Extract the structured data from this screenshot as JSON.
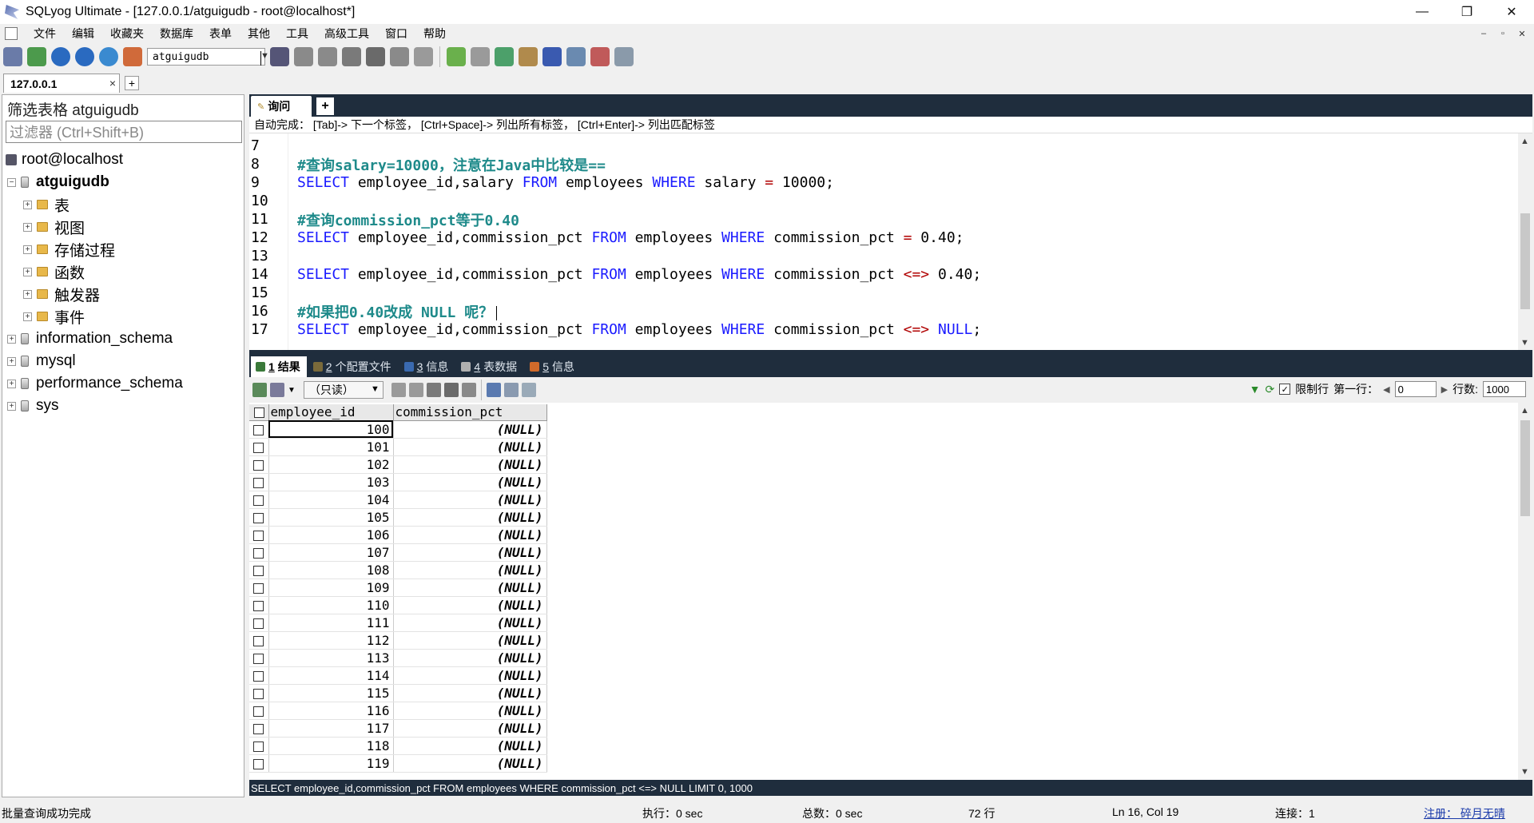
{
  "window": {
    "title": "SQLyog Ultimate - [127.0.0.1/atguigudb - root@localhost*]",
    "controls": [
      "—",
      "❐",
      "✕"
    ]
  },
  "menu": {
    "items": [
      "文件",
      "编辑",
      "收藏夹",
      "数据库",
      "表单",
      "其他",
      "工具",
      "高级工具",
      "窗口",
      "帮助"
    ],
    "mdi_controls": [
      "–",
      "▫",
      "✕"
    ]
  },
  "toolbar": {
    "db_selector": "atguigudb"
  },
  "connection_tab": {
    "label": "127.0.0.1",
    "close": "×",
    "add": "+"
  },
  "object_browser": {
    "filter_title": "筛选表格 atguigudb",
    "filter_placeholder": "过滤器 (Ctrl+Shift+B)",
    "server": "root@localhost",
    "current_db": "atguigudb",
    "folders": [
      "表",
      "视图",
      "存储过程",
      "函数",
      "触发器",
      "事件"
    ],
    "other_dbs": [
      "information_schema",
      "mysql",
      "performance_schema",
      "sys"
    ]
  },
  "query_tab": {
    "label": "询问",
    "add": "+"
  },
  "autocomplete_hint": "自动完成： [Tab]-> 下一个标签， [Ctrl+Space]-> 列出所有标签， [Ctrl+Enter]-> 列出匹配标签",
  "editor": {
    "lines": [
      {
        "n": "7",
        "parts": []
      },
      {
        "n": "8",
        "parts": [
          {
            "t": "#查询salary=10000，注意在Java中比较是==",
            "c": "cm"
          }
        ]
      },
      {
        "n": "9",
        "parts": [
          {
            "t": "SELECT",
            "c": "kw"
          },
          {
            "t": " employee_id,salary ",
            "c": ""
          },
          {
            "t": "FROM",
            "c": "kw"
          },
          {
            "t": " employees ",
            "c": ""
          },
          {
            "t": "WHERE",
            "c": "kw"
          },
          {
            "t": " salary ",
            "c": ""
          },
          {
            "t": "=",
            "c": "op"
          },
          {
            "t": " 10000;",
            "c": ""
          }
        ]
      },
      {
        "n": "10",
        "parts": []
      },
      {
        "n": "11",
        "parts": [
          {
            "t": "#查询commission_pct等于0.40",
            "c": "cm"
          }
        ]
      },
      {
        "n": "12",
        "parts": [
          {
            "t": "SELECT",
            "c": "kw"
          },
          {
            "t": " employee_id,commission_pct ",
            "c": ""
          },
          {
            "t": "FROM",
            "c": "kw"
          },
          {
            "t": " employees ",
            "c": ""
          },
          {
            "t": "WHERE",
            "c": "kw"
          },
          {
            "t": " commission_pct ",
            "c": ""
          },
          {
            "t": "=",
            "c": "op"
          },
          {
            "t": " 0.40;",
            "c": ""
          }
        ]
      },
      {
        "n": "13",
        "parts": []
      },
      {
        "n": "14",
        "parts": [
          {
            "t": "SELECT",
            "c": "kw"
          },
          {
            "t": " employee_id,commission_pct ",
            "c": ""
          },
          {
            "t": "FROM",
            "c": "kw"
          },
          {
            "t": " employees ",
            "c": ""
          },
          {
            "t": "WHERE",
            "c": "kw"
          },
          {
            "t": " commission_pct ",
            "c": ""
          },
          {
            "t": "<=>",
            "c": "op"
          },
          {
            "t": " 0.40;",
            "c": ""
          }
        ]
      },
      {
        "n": "15",
        "parts": []
      },
      {
        "n": "16",
        "parts": [
          {
            "t": "#如果把0.40改成 NULL 呢？",
            "c": "cm"
          }
        ],
        "caret": true
      },
      {
        "n": "17",
        "parts": [
          {
            "t": "SELECT",
            "c": "kw"
          },
          {
            "t": " employee_id,commission_pct ",
            "c": ""
          },
          {
            "t": "FROM",
            "c": "kw"
          },
          {
            "t": " employees ",
            "c": ""
          },
          {
            "t": "WHERE",
            "c": "kw"
          },
          {
            "t": " commission_pct ",
            "c": ""
          },
          {
            "t": "<=>",
            "c": "op"
          },
          {
            "t": " ",
            "c": ""
          },
          {
            "t": "NULL",
            "c": "kw"
          },
          {
            "t": ";",
            "c": ""
          }
        ]
      }
    ]
  },
  "result_tabs": [
    {
      "num": "1",
      "label": "结果",
      "active": true,
      "color": "#3a7a3a"
    },
    {
      "num": "2",
      "label": "个配置文件",
      "active": false,
      "color": "#7a6a3a"
    },
    {
      "num": "3",
      "label": "信息",
      "active": false,
      "color": "#3a6ab0"
    },
    {
      "num": "4",
      "label": "表数据",
      "active": false,
      "color": "#b0b0b0"
    },
    {
      "num": "5",
      "label": "信息",
      "active": false,
      "color": "#d06a2a"
    }
  ],
  "result_toolbar": {
    "mode": "（只读）",
    "limit_label": "限制行",
    "limit_checked": true,
    "first_row_label": "第一行：",
    "first_row_value": "0",
    "rows_label": "行数:",
    "rows_value": "1000"
  },
  "grid": {
    "columns": [
      "employee_id",
      "commission_pct"
    ],
    "rows": [
      [
        "100",
        "(NULL)"
      ],
      [
        "101",
        "(NULL)"
      ],
      [
        "102",
        "(NULL)"
      ],
      [
        "103",
        "(NULL)"
      ],
      [
        "104",
        "(NULL)"
      ],
      [
        "105",
        "(NULL)"
      ],
      [
        "106",
        "(NULL)"
      ],
      [
        "107",
        "(NULL)"
      ],
      [
        "108",
        "(NULL)"
      ],
      [
        "109",
        "(NULL)"
      ],
      [
        "110",
        "(NULL)"
      ],
      [
        "111",
        "(NULL)"
      ],
      [
        "112",
        "(NULL)"
      ],
      [
        "113",
        "(NULL)"
      ],
      [
        "114",
        "(NULL)"
      ],
      [
        "115",
        "(NULL)"
      ],
      [
        "116",
        "(NULL)"
      ],
      [
        "117",
        "(NULL)"
      ],
      [
        "118",
        "(NULL)"
      ],
      [
        "119",
        "(NULL)"
      ]
    ]
  },
  "query_status": "SELECT employee_id,commission_pct FROM employees WHERE commission_pct <=> NULL LIMIT 0, 1000",
  "statusbar": {
    "message": "批量查询成功完成",
    "exec": "执行：0 sec",
    "total": "总数：0 sec",
    "rows": "72 行",
    "position": "Ln 16, Col 19",
    "connections": "连接：1",
    "registration": "注册：  碎月无晴"
  }
}
